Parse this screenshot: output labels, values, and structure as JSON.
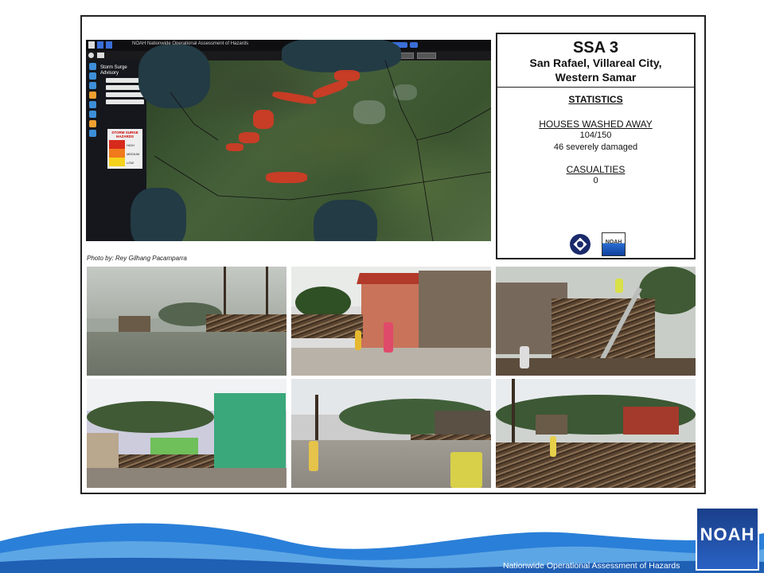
{
  "map": {
    "topbar_title": "NOAH    Nationwide Operational Assessment of Hazards",
    "sidebar_title_1": "Storm Surge",
    "sidebar_title_2": "Advisory",
    "legend_title_1": "STORM SURGE",
    "legend_title_2": "HAZARDS",
    "legend_high": "HIGH",
    "legend_medium": "MEDIUM",
    "legend_low": "LOW"
  },
  "photo_credit": "Photo by: Rey Gilhang Pacamparra",
  "panel": {
    "title": "SSA 3",
    "location_line1": "San Rafael, Villareal City,",
    "location_line2": "Western Samar",
    "stats_heading": "STATISTICS",
    "houses_heading": "HOUSES WASHED AWAY",
    "houses_value": "104/150",
    "damaged_value": "46 severely damaged",
    "casualties_heading": "CASUALTIES",
    "casualties_value": "0",
    "logo_b_text": "NOAH"
  },
  "footer": {
    "tagline": "Nationwide Operational Assessment of Hazards",
    "logo_text": "NOAH"
  },
  "colors": {
    "surge_high": "#d33b24",
    "sidebar_icon": "#3d8fd8",
    "footer_wave": "#2a7fd8"
  }
}
